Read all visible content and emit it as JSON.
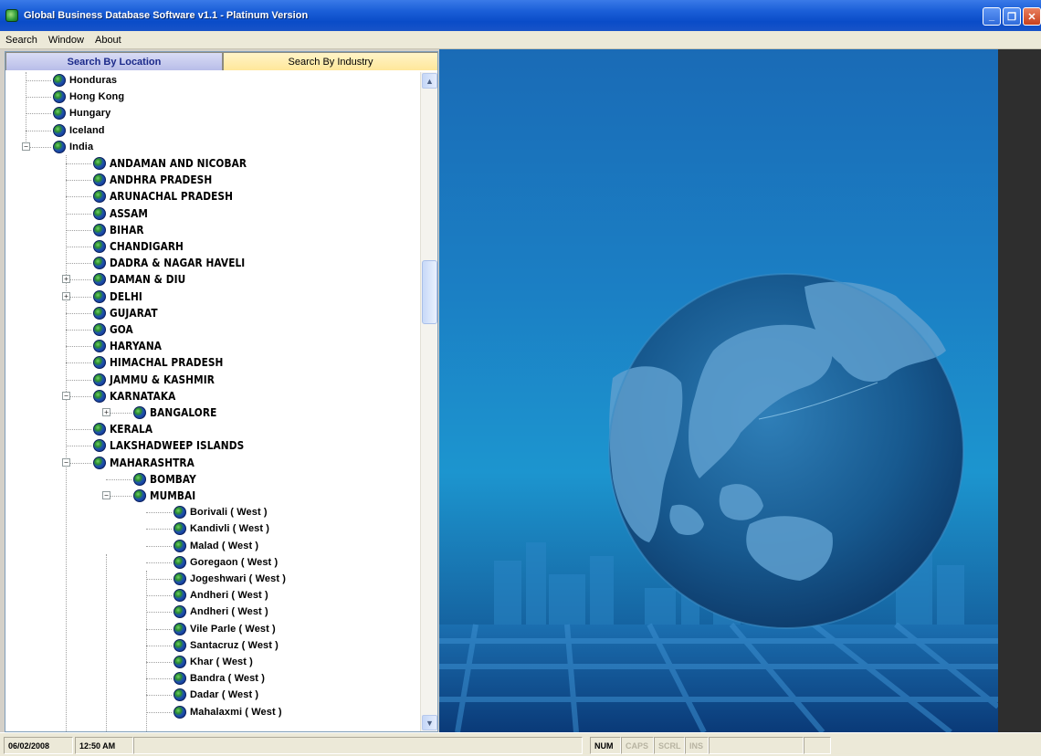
{
  "window": {
    "title": "Global Business Database Software v1.1 - Platinum Version",
    "controls": {
      "minimize": "_",
      "maximize": "❐",
      "close": "✕"
    }
  },
  "menu": [
    "Search",
    "Window",
    "About"
  ],
  "tabs": {
    "location": "Search By Location",
    "industry": "Search By Industry"
  },
  "tree": {
    "countries": [
      "Honduras",
      "Hong Kong",
      "Hungary",
      "Iceland",
      "India"
    ],
    "india_states": [
      "ANDAMAN AND NICOBAR",
      "ANDHRA PRADESH",
      "ARUNACHAL PRADESH",
      "ASSAM",
      "BIHAR",
      "CHANDIGARH",
      "DADRA & NAGAR HAVELI",
      "DAMAN & DIU",
      "DELHI",
      "GUJARAT",
      "GOA",
      "HARYANA",
      "HIMACHAL PRADESH",
      "JAMMU & KASHMIR",
      "KARNATAKA"
    ],
    "karnataka_cities": [
      "BANGALORE"
    ],
    "india_states_2": [
      "KERALA",
      "LAKSHADWEEP ISLANDS",
      "MAHARASHTRA"
    ],
    "maharashtra_cities": [
      "BOMBAY",
      "MUMBAI"
    ],
    "mumbai_areas": [
      "Borivali ( West )",
      "Kandivli ( West )",
      "Malad ( West )",
      "Goregaon ( West )",
      "Jogeshwari ( West )",
      "Andheri ( West )",
      "Andheri ( West )",
      "Vile Parle ( West )",
      "Santacruz ( West )",
      "Khar ( West )",
      "Bandra ( West )",
      "Dadar ( West )",
      "Mahalaxmi ( West )"
    ],
    "expanders": {
      "collapse": "−",
      "expand": "+"
    }
  },
  "scrollbar": {
    "up": "▲",
    "down": "▼"
  },
  "status": {
    "date": "06/02/2008",
    "time": "12:50 AM",
    "num": "NUM",
    "caps": "CAPS",
    "scrl": "SCRL",
    "ins": "INS"
  },
  "colors": {
    "title_bar": "#0a4cc8",
    "tab_active": "#b8bde8",
    "tab_inactive": "#ffe79a",
    "background_blue": "#1c95cf",
    "globe_sea": "#0f4f86"
  }
}
